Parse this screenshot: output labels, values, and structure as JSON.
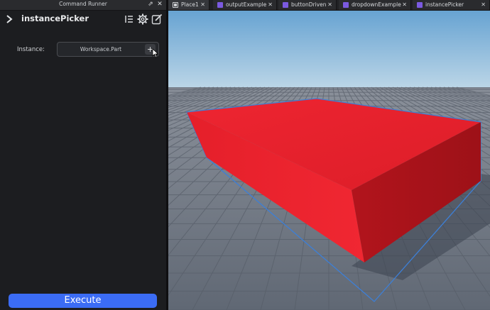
{
  "panel": {
    "window_title": "Command Runner",
    "header_title": "instancePicker",
    "instance_label": "Instance:",
    "instance_value": "Workspace.Part",
    "pick_glyph": "+",
    "execute_label": "Execute",
    "header_icons": [
      "list-icon",
      "gear-icon",
      "edit-icon"
    ]
  },
  "titlebar": {
    "float_glyph": "⇗",
    "close_glyph": "✕"
  },
  "tabs": [
    {
      "label": "Place1",
      "icon": "place-icon",
      "close": "✕",
      "active": true
    },
    {
      "label": "outputExample",
      "icon": "script-icon",
      "close": "✕",
      "active": false
    },
    {
      "label": "buttonDriven",
      "icon": "script-icon",
      "close": "✕",
      "active": false
    },
    {
      "label": "dropdownExample",
      "icon": "script-icon",
      "close": "✕",
      "active": false
    },
    {
      "label": "instancePicker",
      "icon": "script-icon",
      "close": "✕",
      "active": false
    }
  ],
  "colors": {
    "accent": "#3b6cf5",
    "part": "#e8232e",
    "selection": "#3d7fd6",
    "sky_top": "#6aa6d4",
    "sky_bottom": "#b9d4e6",
    "ground": "#6b7380",
    "tab_script_icon": "#7b5ae0"
  }
}
